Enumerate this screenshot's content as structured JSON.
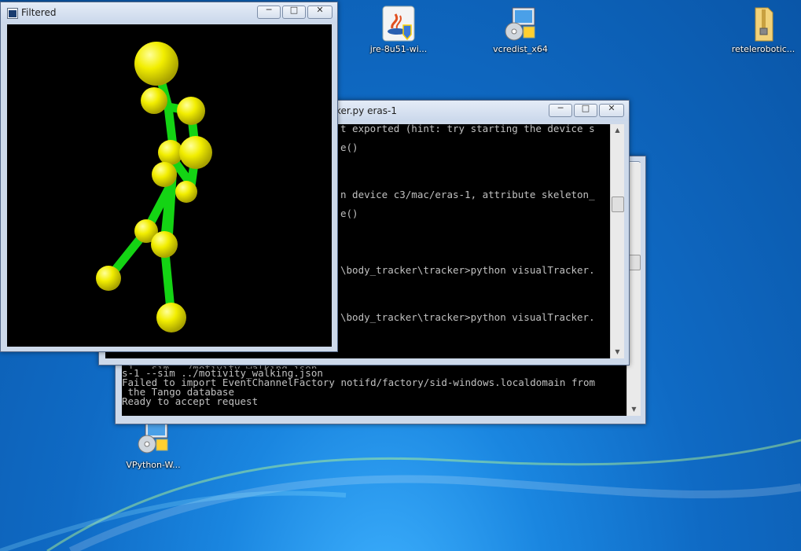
{
  "desktop": {
    "icons": [
      {
        "label": "jre-8u51-wi...",
        "icon": "java-installer-icon"
      },
      {
        "label": "vcredist_x64",
        "icon": "installer-icon"
      },
      {
        "label": "retelerobotic...",
        "icon": "folder-zip-icon"
      },
      {
        "label": "VPython-W...",
        "icon": "installer-icon"
      }
    ]
  },
  "filtered_window": {
    "title": "Filtered",
    "minimize": "─",
    "maximize": "□",
    "close": "✕"
  },
  "tracker_window": {
    "title": "ker.py eras-1",
    "minimize": "─",
    "maximize": "□",
    "close": "✕",
    "lines": [
      "t exported (hint: try starting the device s",
      "",
      "e()",
      "",
      "",
      "",
      "",
      "n device c3/mac/eras-1, attribute skeleton_",
      "",
      "e()",
      "",
      "",
      "",
      "",
      "",
      "\\body_tracker\\tracker>python visualTracker.",
      "",
      "",
      "",
      "",
      "\\body_tracker\\tracker>python visualTracker."
    ]
  },
  "back_console": {
    "lines": [
      "s-1 --sim ../motivity_walking.json",
      "Failed to import EventChannelFactory notifd/factory/sid-windows.localdomain from",
      " the Tango database",
      "Ready to accept request"
    ]
  },
  "colors": {
    "skeleton_joint": "#f2ee00",
    "skeleton_bone": "#14d414",
    "scene_bg": "#000000"
  }
}
